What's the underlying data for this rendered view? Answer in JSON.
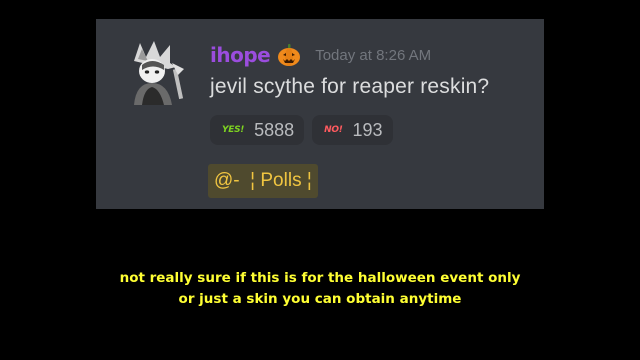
{
  "message": {
    "author": "ihope",
    "author_badge_icon": "jack-o-lantern-icon",
    "author_color": "#9b4dde",
    "timestamp": "Today at 8:26 AM",
    "content": "jevil scythe for reaper reskin?",
    "reactions": [
      {
        "emoji_label": "YES!",
        "emoji_color": "#7ed321",
        "count": "5888"
      },
      {
        "emoji_label": "NO!",
        "emoji_color": "#ff5a5f",
        "count": "193"
      }
    ],
    "channel_mention": "@-  ¦ Polls ¦"
  },
  "caption": {
    "line1": "not really sure if this is for the halloween event only",
    "line2": "or just a skin you can obtain anytime",
    "color": "#ffff33"
  }
}
